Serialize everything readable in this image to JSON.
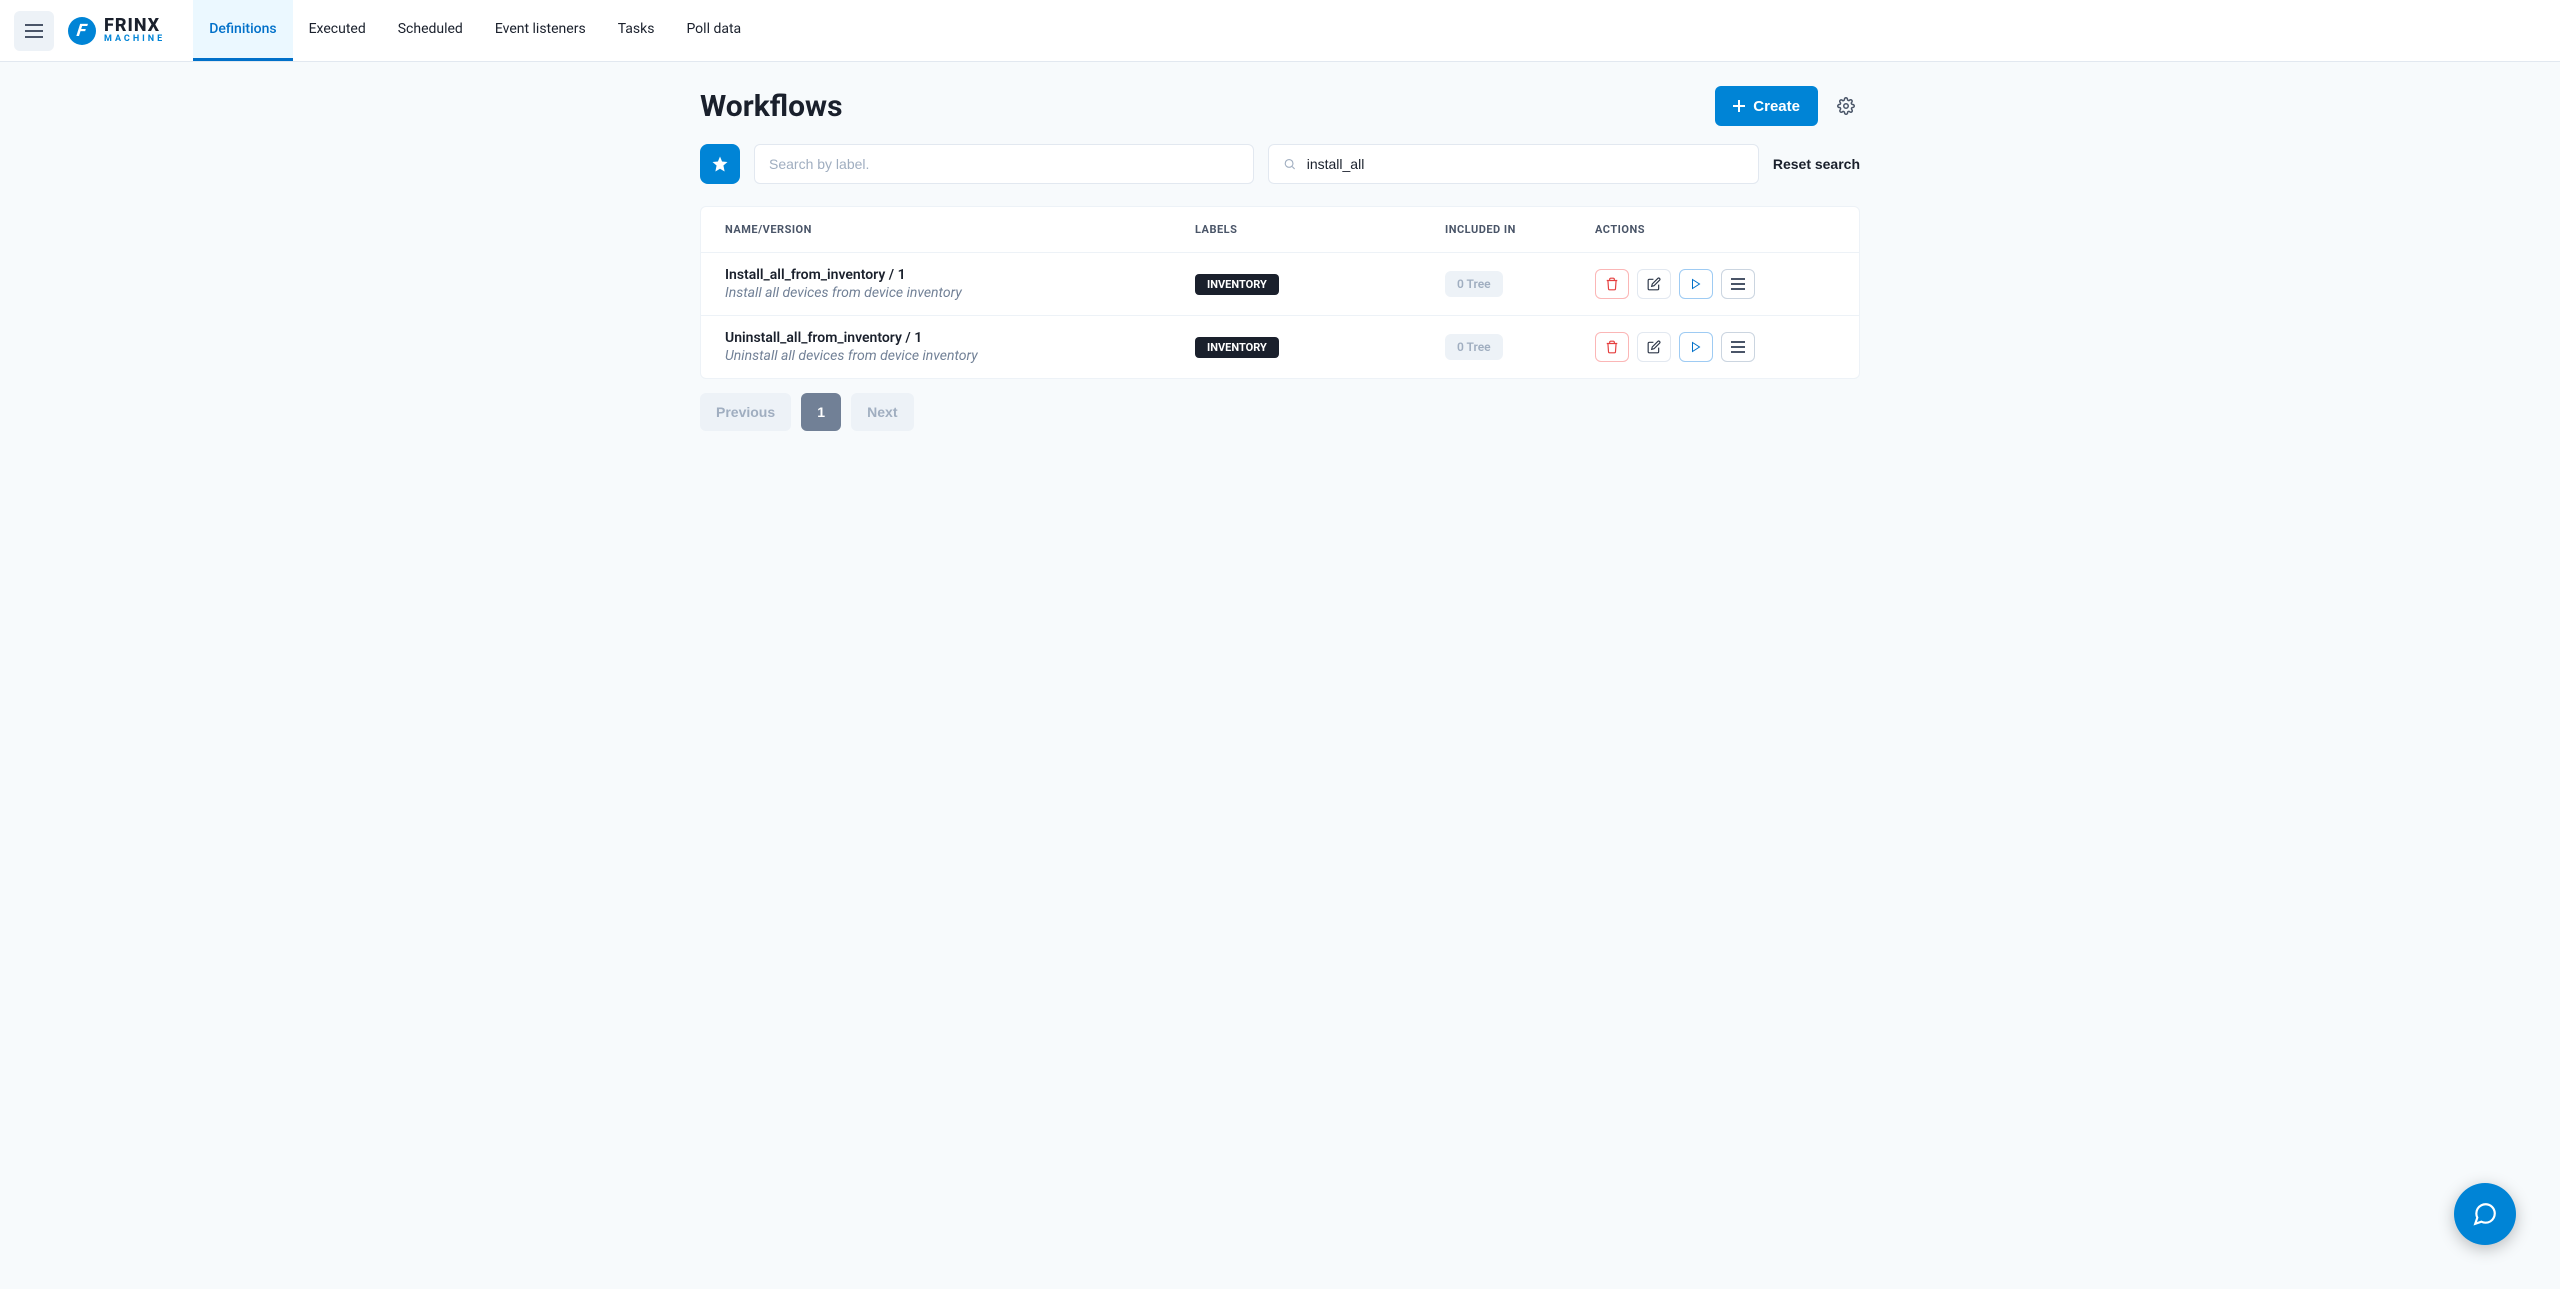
{
  "brand": {
    "name": "FRINX",
    "sub": "MACHINE"
  },
  "nav": {
    "tabs": [
      {
        "label": "Definitions",
        "active": true
      },
      {
        "label": "Executed",
        "active": false
      },
      {
        "label": "Scheduled",
        "active": false
      },
      {
        "label": "Event listeners",
        "active": false
      },
      {
        "label": "Tasks",
        "active": false
      },
      {
        "label": "Poll data",
        "active": false
      }
    ]
  },
  "page": {
    "title": "Workflows",
    "create_label": "Create",
    "reset_label": "Reset search"
  },
  "search": {
    "label_placeholder": "Search by label.",
    "label_value": "",
    "keyword_value": "install_all"
  },
  "table": {
    "headers": {
      "name": "NAME/VERSION",
      "labels": "LABELS",
      "included": "INCLUDED IN",
      "actions": "ACTIONS"
    },
    "rows": [
      {
        "name": "Install_all_from_inventory / 1",
        "desc": "Install all devices from device inventory",
        "label": "INVENTORY",
        "included": "0 Tree"
      },
      {
        "name": "Uninstall_all_from_inventory / 1",
        "desc": "Uninstall all devices from device inventory",
        "label": "INVENTORY",
        "included": "0 Tree"
      }
    ]
  },
  "pagination": {
    "prev": "Previous",
    "next": "Next",
    "current": "1"
  }
}
